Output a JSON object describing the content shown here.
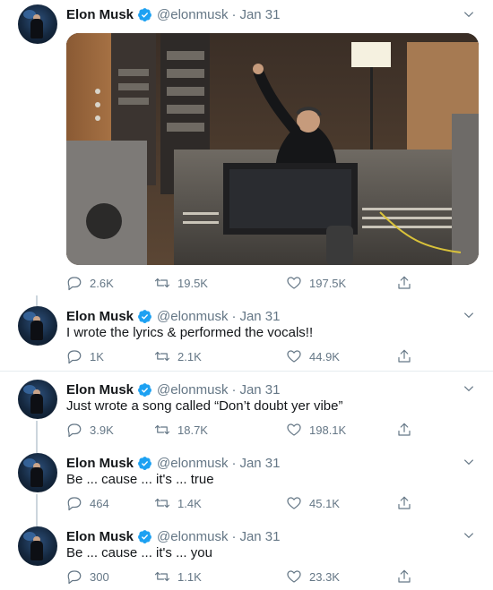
{
  "author": {
    "name": "Elon Musk",
    "handle": "@elonmusk",
    "separator": "·"
  },
  "colors": {
    "verified": "#1da1f2",
    "text_secondary": "#657786",
    "divider": "#e6ecf0"
  },
  "tweets": [
    {
      "date": "Jan 31",
      "text": "",
      "has_media": true,
      "replies": "2.6K",
      "retweets": "19.5K",
      "likes": "197.5K"
    },
    {
      "date": "Jan 31",
      "text": "I wrote the lyrics & performed the vocals!!",
      "replies": "1K",
      "retweets": "2.1K",
      "likes": "44.9K"
    },
    {
      "date": "Jan 31",
      "text": "Just wrote a song called “Don’t doubt yer vibe”",
      "replies": "3.9K",
      "retweets": "18.7K",
      "likes": "198.1K"
    },
    {
      "date": "Jan 31",
      "text": "Be ... cause ... it's ... true",
      "replies": "464",
      "retweets": "1.4K",
      "likes": "45.1K"
    },
    {
      "date": "Jan 31",
      "text": "Be ... cause ... it's ... you",
      "replies": "300",
      "retweets": "1.1K",
      "likes": "23.3K"
    }
  ],
  "icons": {
    "reply": "reply-icon",
    "retweet": "retweet-icon",
    "like": "heart-icon",
    "share": "share-icon",
    "menu": "chevron-down-icon",
    "verified": "verified-badge-icon"
  }
}
